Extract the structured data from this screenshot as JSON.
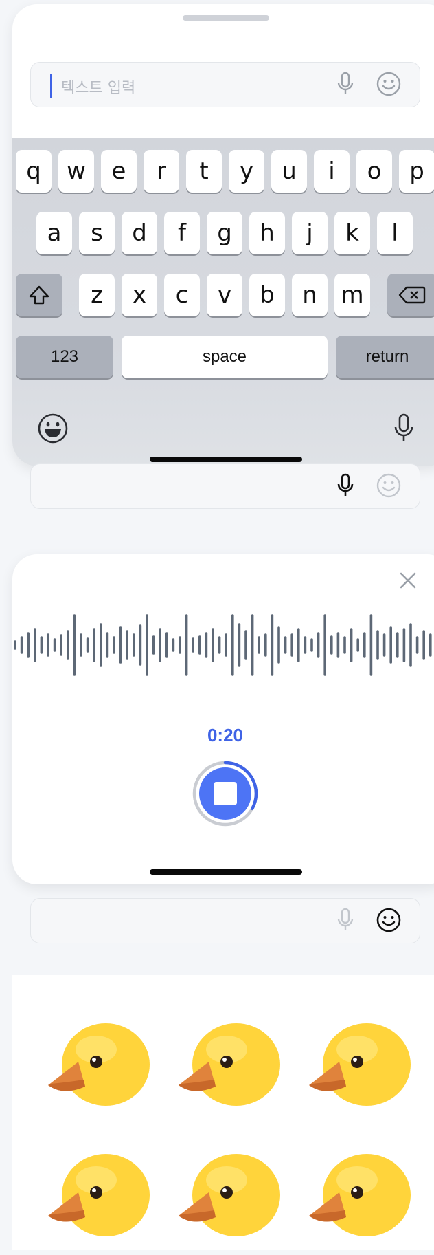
{
  "keyboard_panel": {
    "input": {
      "placeholder": "텍스트 입력",
      "mic_icon": "microphone-icon",
      "emoji_icon": "smiley-icon"
    },
    "keyboard": {
      "row1": [
        "q",
        "w",
        "e",
        "r",
        "t",
        "y",
        "u",
        "i",
        "o",
        "p"
      ],
      "row2": [
        "a",
        "s",
        "d",
        "f",
        "g",
        "h",
        "j",
        "k",
        "l"
      ],
      "row3": [
        "z",
        "x",
        "c",
        "v",
        "b",
        "n",
        "m"
      ],
      "numbers_label": "123",
      "space_label": "space",
      "return_label": "return",
      "shift_icon": "shift-icon",
      "delete_icon": "backspace-icon",
      "emoji_icon": "grinning-face-icon",
      "dictation_icon": "microphone-icon"
    }
  },
  "voice_input_bar": {
    "mic_icon": "microphone-icon",
    "emoji_icon": "smiley-icon"
  },
  "recording_panel": {
    "close_icon": "close-icon",
    "waveform_icon": "waveform-icon",
    "timer": "0:20",
    "stop_icon": "stop-icon",
    "progress_fraction": 0.33
  },
  "emoji_input_bar": {
    "mic_icon": "microphone-icon",
    "emoji_icon": "smiley-icon"
  },
  "emoji_panel": {
    "items": [
      "🐤",
      "🐤",
      "🐤",
      "🐤",
      "🐤",
      "🐤"
    ]
  },
  "colors": {
    "accent": "#3f63e6",
    "keyboard_bg": "#d2d5db",
    "waveform": "#5d6876",
    "background": "#f4f6f9"
  }
}
